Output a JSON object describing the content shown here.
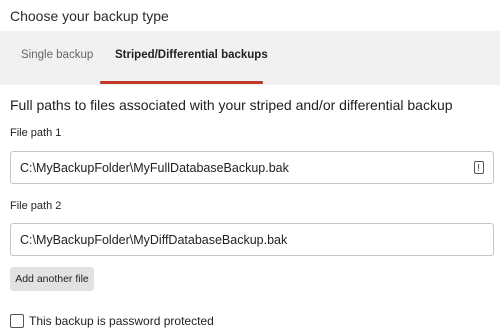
{
  "page": {
    "title": "Choose your backup type"
  },
  "tabs": [
    {
      "label": "Single backup",
      "selected": false
    },
    {
      "label": "Striped/Differential backups",
      "selected": true
    }
  ],
  "colors": {
    "accent": "#c0392b",
    "tab_bar_bg": "#f1f1f1"
  },
  "section": {
    "heading": "Full paths to files associated with your striped and/or differential backup"
  },
  "fields": [
    {
      "label": "File path 1",
      "value": "C:\\MyBackupFolder\\MyFullDatabaseBackup.bak",
      "icon": "info-icon"
    },
    {
      "label": "File path 2",
      "value": "C:\\MyBackupFolder\\MyDiffDatabaseBackup.bak"
    }
  ],
  "actions": {
    "add_file_label": "Add another file"
  },
  "password": {
    "label": "This backup is password protected",
    "checked": false
  }
}
